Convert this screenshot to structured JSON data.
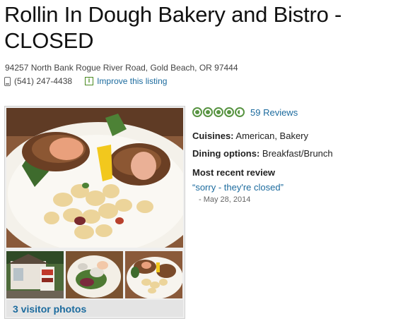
{
  "listing": {
    "title": "Rollin In Dough Bakery and Bistro - CLOSED",
    "address": "94257 North Bank Rogue River Road, Gold Beach, OR 97444",
    "phone": "(541) 247-4438",
    "improve_label": "Improve this listing"
  },
  "rating": {
    "bubbles": 4.5,
    "max": 5,
    "reviews_label": "59 Reviews",
    "color": "#589442"
  },
  "details": {
    "cuisines_label": "Cuisines:",
    "cuisines_value": " American, Bakery",
    "dining_label": "Dining options:",
    "dining_value": " Breakfast/Brunch"
  },
  "recent_review": {
    "heading": "Most recent review",
    "quote": "“sorry - they're closed”",
    "date": "- May 28, 2014"
  },
  "photos": {
    "visitor_label": "3 visitor photos",
    "thumbnails": [
      "storefront-photo",
      "salad-photo",
      "crab-cake-plate-photo"
    ]
  },
  "colors": {
    "link": "#1c6b9e",
    "bubble_green": "#589442",
    "info_green": "#4a8a21"
  }
}
